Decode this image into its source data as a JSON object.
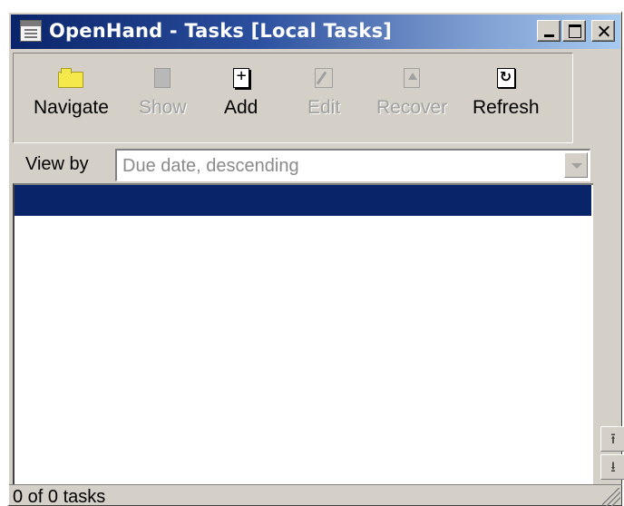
{
  "window": {
    "title": "OpenHand - Tasks [Local Tasks]"
  },
  "titlebar": {
    "icon": "app-window-icon",
    "controls": [
      "minimize",
      "maximize",
      "close"
    ]
  },
  "toolbar": {
    "items": [
      {
        "label": "Navigate",
        "icon": "folder-icon",
        "enabled": true
      },
      {
        "label": "Show",
        "icon": "show-icon",
        "enabled": false
      },
      {
        "label": "Add",
        "icon": "add-icon",
        "enabled": true
      },
      {
        "label": "Edit",
        "icon": "edit-icon",
        "enabled": false
      },
      {
        "label": "Recover",
        "icon": "recover-icon",
        "enabled": false
      },
      {
        "label": "Refresh",
        "icon": "refresh-icon",
        "enabled": true
      }
    ]
  },
  "view_by": {
    "label": "View by",
    "selected": "Due date, descending"
  },
  "status": {
    "text": "0 of 0 tasks"
  },
  "colors": {
    "title_gradient_start": "#0a246a",
    "title_gradient_end": "#a6caf0",
    "selection": "#0a246a",
    "face": "#d4d0c8",
    "disabled_text": "#a0a0a0"
  }
}
